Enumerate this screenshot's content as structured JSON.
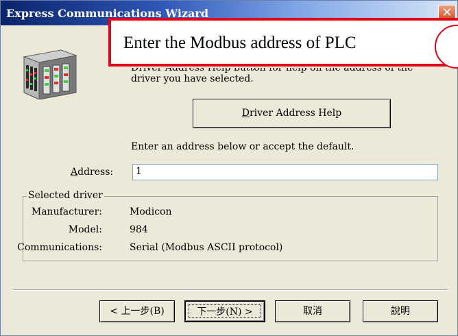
{
  "window": {
    "title": "Express Communications Wizard",
    "close_glyph": "✕"
  },
  "callout": {
    "text": "Enter the Modbus address of PLC"
  },
  "help_text": "Driver Address Help button for help on the address of the driver you have selected.",
  "driver_address_help_button": {
    "label_underlined": "D",
    "label_rest": "river Address Help"
  },
  "enter_address_text": "Enter an address below or accept the default.",
  "address": {
    "label_underlined": "A",
    "label_rest": "ddress:",
    "value": "1"
  },
  "selected_driver": {
    "legend": "Selected driver",
    "manufacturer_label": "Manufacturer:",
    "manufacturer_value": "Modicon",
    "model_label": "Model:",
    "model_value": "984",
    "communications_label": "Communications:",
    "communications_value": "Serial (Modbus ASCII protocol)"
  },
  "buttons": {
    "back": "< 上一步(B)",
    "next": "下一步(N) >",
    "cancel": "取消",
    "help": "說明"
  },
  "icon": {
    "wizard_icon": "plc-cabinet-icon"
  },
  "colors": {
    "title_bar_start": "#0a246a",
    "dialog_bg": "#ece9d8",
    "callout_border": "#e0001a",
    "close_button": "#d24a1e"
  }
}
